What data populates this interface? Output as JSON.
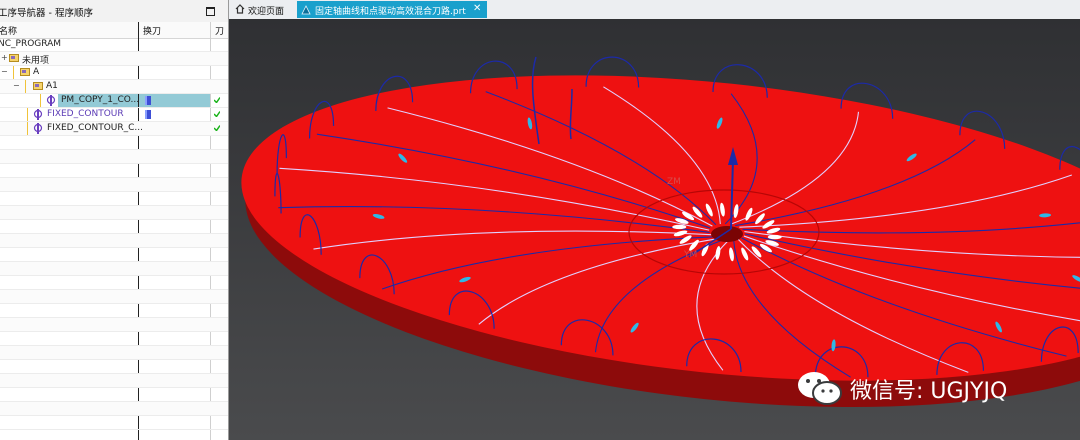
{
  "navigator": {
    "title": "工序导航器 - 程序顺序",
    "columns": {
      "name": "名称",
      "tool_change": "换刀",
      "path": "刀"
    },
    "rows": [
      {
        "label": "NC_PROGRAM",
        "level": 0
      },
      {
        "label": "未用项",
        "level": 1,
        "toggle": "+"
      },
      {
        "label": "A",
        "level": 1,
        "toggle": "−"
      },
      {
        "label": "A1",
        "level": 2,
        "toggle": "−"
      },
      {
        "label": "PM_COPY_1_CO...",
        "level": 3,
        "selected": true,
        "has_tool": true,
        "status": "ok"
      },
      {
        "label": "FIXED_CONTOUR",
        "level": 2,
        "has_tool": true,
        "status": "ok"
      },
      {
        "label": "FIXED_CONTOUR_C...",
        "level": 2,
        "status": "ok"
      }
    ]
  },
  "tabs": {
    "home": "欢迎页面",
    "part": "固定轴曲线和点驱动高效混合刀路.prt"
  },
  "watermark": {
    "text": "微信号: UGJYJQ"
  },
  "colors": {
    "part_red": "#ee1111",
    "toolpath_blue": "#1c2aa8",
    "tab_active": "#1aa0cc",
    "selection": "#93cad6"
  },
  "viewport": {
    "axis_labels": [
      "ZM",
      "YM"
    ]
  }
}
